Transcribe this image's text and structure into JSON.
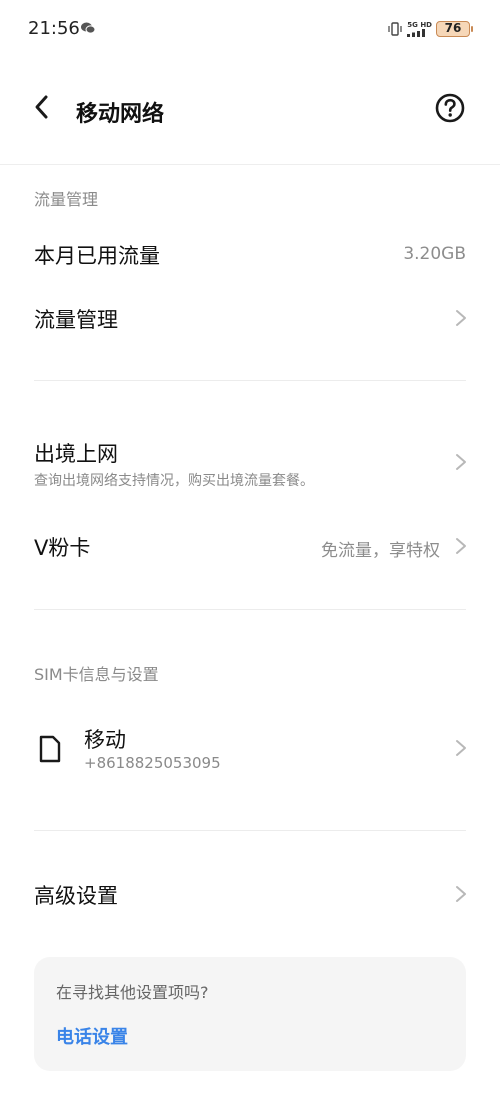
{
  "statusbar": {
    "time": "21:56",
    "net_top": "5G HD",
    "battery": "76"
  },
  "header": {
    "title": "移动网络"
  },
  "traffic": {
    "section_title": "流量管理",
    "used_label": "本月已用流量",
    "used_value": "3.20GB",
    "manage_label": "流量管理"
  },
  "roaming": {
    "label": "出境上网",
    "sub": "查询出境网络支持情况，购买出境流量套餐。"
  },
  "vcard": {
    "label": "V粉卡",
    "value": "免流量，享特权"
  },
  "sim": {
    "section_title": "SIM卡信息与设置",
    "name": "移动",
    "number": "+8618825053095"
  },
  "advanced": {
    "label": "高级设置"
  },
  "card": {
    "question": "在寻找其他设置项吗?",
    "link": "电话设置"
  },
  "colors": {
    "accent": "#3a84e8",
    "secondary_text": "#8a8a8a"
  }
}
